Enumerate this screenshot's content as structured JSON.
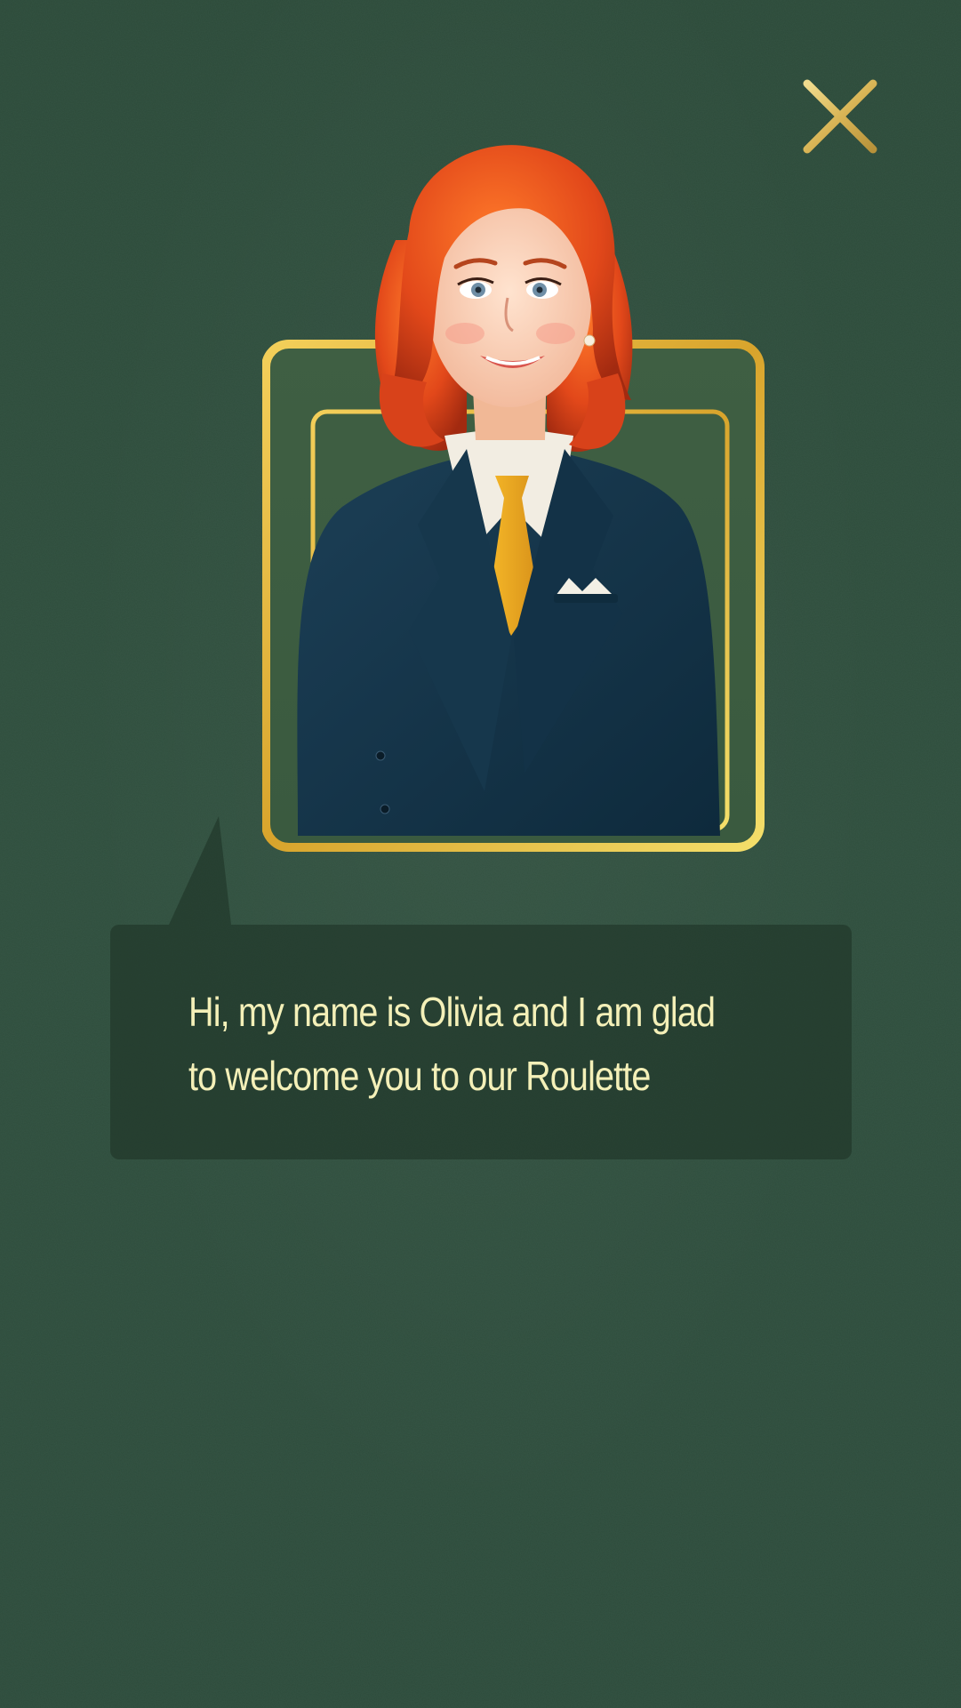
{
  "close_button": {
    "icon": "close-icon",
    "color": "#e3c56a"
  },
  "portrait": {
    "frame_color": "#e2b53a"
  },
  "dialog": {
    "line1": "Hi, my name is Olivia and I am glad",
    "line2": "to welcome you to our Roulette"
  }
}
